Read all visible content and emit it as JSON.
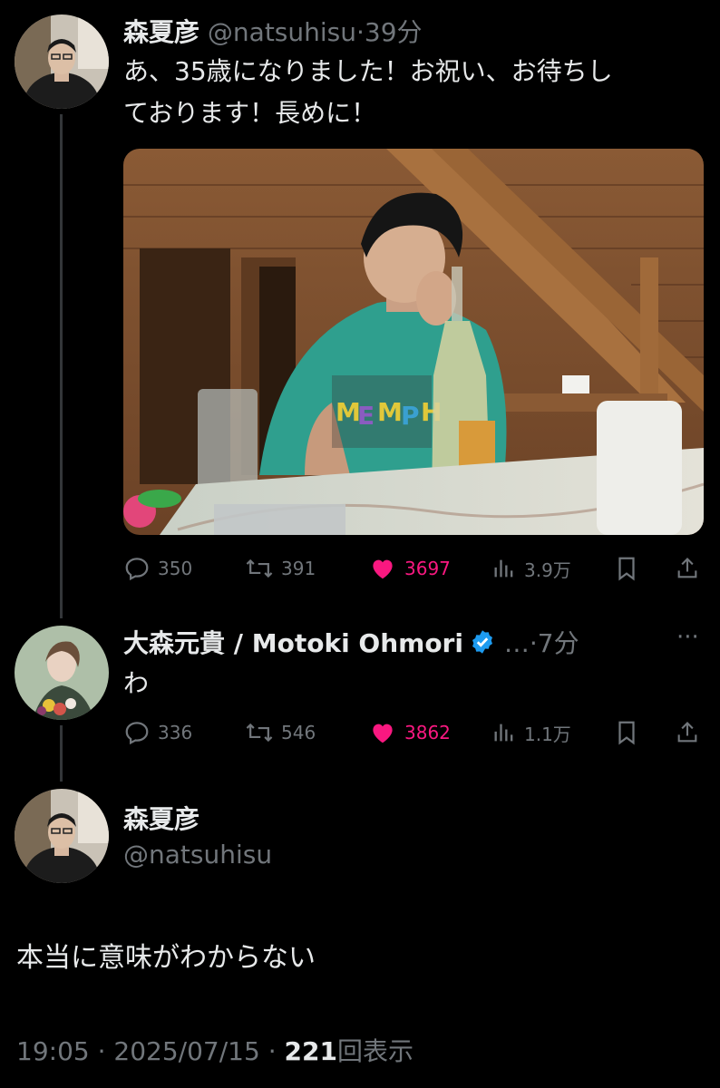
{
  "tweet1": {
    "display_name": "森夏彦",
    "handle": "@natsuhisu",
    "separator": "·",
    "time": "39分",
    "text_line1": "あ、35歳になりました！お祝い、お待ちし",
    "text_line2": "ております！長めに！",
    "actions": {
      "replies": "350",
      "retweets": "391",
      "likes": "3697",
      "views": "3.9万"
    }
  },
  "tweet2": {
    "display_name": "大森元貴 / Motoki Ohmori",
    "ellipsis": "…",
    "separator": "·",
    "time": "7分",
    "more": "···",
    "text": "わ",
    "actions": {
      "replies": "336",
      "retweets": "546",
      "likes": "3862",
      "views": "1.1万"
    }
  },
  "main_tweet": {
    "display_name": "森夏彦",
    "handle": "@natsuhisu",
    "text": "本当に意味がわからない",
    "time": "19:05",
    "sep1": "·",
    "date": "2025/07/15",
    "sep2": "·",
    "views_count": "221",
    "views_label": "回表示"
  },
  "colors": {
    "background": "#000000",
    "text": "#e7e9ea",
    "muted": "#71767b",
    "like": "#f91880",
    "verified": "#1d9bf0"
  },
  "icons": [
    "reply-icon",
    "retweet-icon",
    "like-icon",
    "views-icon",
    "bookmark-icon",
    "share-icon",
    "verified-badge-icon",
    "more-icon"
  ]
}
